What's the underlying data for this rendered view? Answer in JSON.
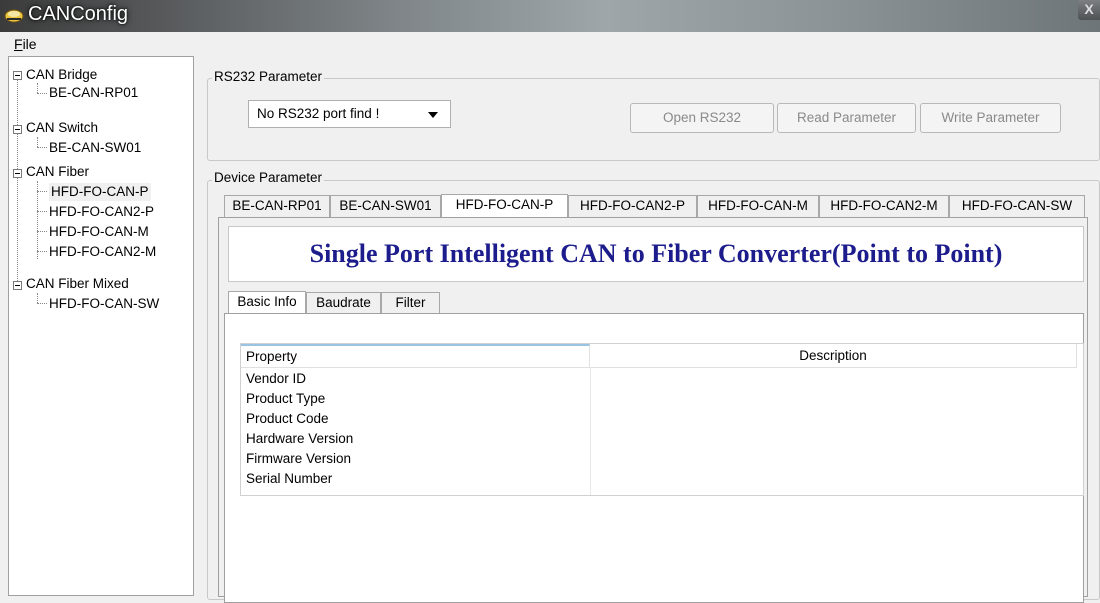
{
  "window": {
    "title": "CANConfig",
    "close_label": "X"
  },
  "menu": {
    "file_label": "File"
  },
  "tree": {
    "groups": [
      {
        "label": "CAN Bridge",
        "children": [
          "BE-CAN-RP01"
        ]
      },
      {
        "label": "CAN Switch",
        "children": [
          "BE-CAN-SW01"
        ]
      },
      {
        "label": "CAN Fiber",
        "children": [
          "HFD-FO-CAN-P",
          "HFD-FO-CAN2-P",
          "HFD-FO-CAN-M",
          "HFD-FO-CAN2-M"
        ]
      },
      {
        "label": "CAN Fiber Mixed",
        "children": [
          "HFD-FO-CAN-SW"
        ]
      }
    ],
    "selected": "HFD-FO-CAN-P"
  },
  "rs232": {
    "group_label": "RS232 Parameter",
    "port_value": "No RS232 port find !",
    "open_button": "Open RS232",
    "read_button": "Read Parameter",
    "write_button": "Write Parameter"
  },
  "device": {
    "group_label": "Device Parameter",
    "tabs": [
      "BE-CAN-RP01",
      "BE-CAN-SW01",
      "HFD-FO-CAN-P",
      "HFD-FO-CAN2-P",
      "HFD-FO-CAN-M",
      "HFD-FO-CAN2-M",
      "HFD-FO-CAN-SW"
    ],
    "active_tab": "HFD-FO-CAN-P",
    "banner": "Single Port Intelligent CAN to Fiber Converter(Point to Point)",
    "sub_tabs": [
      "Basic Info",
      "Baudrate",
      "Filter"
    ],
    "active_sub_tab": "Basic Info",
    "table": {
      "columns": [
        "Property",
        "Description"
      ],
      "rows": [
        {
          "property": "Vendor ID",
          "description": ""
        },
        {
          "property": "Product Type",
          "description": ""
        },
        {
          "property": "Product Code",
          "description": ""
        },
        {
          "property": "Hardware Version",
          "description": ""
        },
        {
          "property": "Firmware Version",
          "description": ""
        },
        {
          "property": "Serial Number",
          "description": ""
        }
      ]
    }
  },
  "colors": {
    "banner_text": "#1c1c8c",
    "header_accent": "#9ac4e4"
  }
}
